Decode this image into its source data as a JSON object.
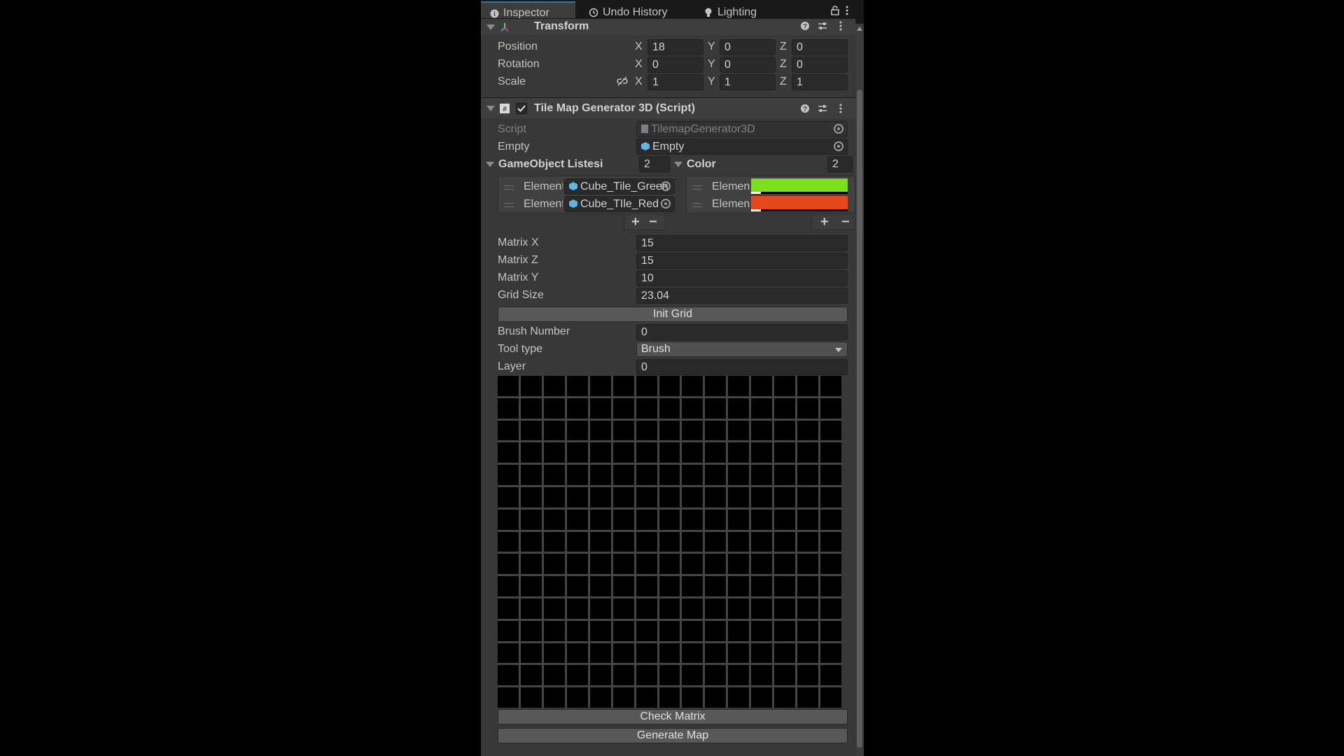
{
  "tabs": [
    {
      "label": "Inspector",
      "icon": "info-icon"
    },
    {
      "label": "Undo History",
      "icon": "history-icon"
    },
    {
      "label": "Lighting",
      "icon": "bulb-icon"
    }
  ],
  "transform": {
    "title": "Transform",
    "rows": [
      {
        "label": "Position",
        "x": "18",
        "y": "0",
        "z": "0"
      },
      {
        "label": "Rotation",
        "x": "0",
        "y": "0",
        "z": "0"
      },
      {
        "label": "Scale",
        "x": "1",
        "y": "1",
        "z": "1"
      }
    ],
    "axes": {
      "x": "X",
      "y": "Y",
      "z": "Z"
    }
  },
  "script": {
    "title": "Tile Map Generator 3D (Script)",
    "enabled": true,
    "script_label": "Script",
    "script_value": "TilemapGenerator3D",
    "empty_label": "Empty",
    "empty_value": "Empty",
    "go_list_label": "GameObject Listesi",
    "go_list_count": "2",
    "go_elements": [
      {
        "label": "Element",
        "value": "Cube_Tile_Green"
      },
      {
        "label": "Element",
        "value": "Cube_TIle_Red"
      }
    ],
    "color_label": "Color",
    "color_count": "2",
    "color_elements": [
      {
        "label": "Element",
        "color": "#7be01c"
      },
      {
        "label": "Element",
        "color": "#e6481b"
      }
    ],
    "plus": "+",
    "minus": "−",
    "matrix_x_label": "Matrix X",
    "matrix_x": "15",
    "matrix_z_label": "Matrix Z",
    "matrix_z": "15",
    "matrix_y_label": "Matrix Y",
    "matrix_y": "10",
    "grid_size_label": "Grid Size",
    "grid_size": "23.04",
    "init_grid": "Init Grid",
    "brush_number_label": "Brush Number",
    "brush_number": "0",
    "tool_type_label": "Tool type",
    "tool_type": "Brush",
    "layer_label": "Layer",
    "layer": "0",
    "grid_cols": 15,
    "grid_rows": 15,
    "grid_cell_color": "#000000",
    "grid_line_color": "#444444",
    "check_matrix": "Check Matrix",
    "generate_map": "Generate Map"
  }
}
